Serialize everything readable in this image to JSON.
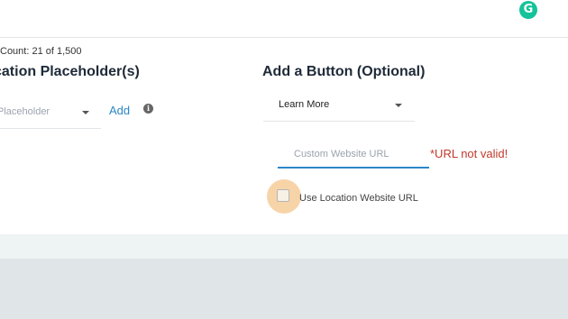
{
  "header": {
    "grammarly_letter": "G"
  },
  "character_count": "Count: 21 of 1,500",
  "location_section": {
    "title": "cation Placeholder(s)",
    "select_placeholder": "Placeholder",
    "add_label": "Add",
    "info_icon": "i"
  },
  "button_section": {
    "title": "Add a Button (Optional)",
    "selected_action": "Learn More",
    "url_placeholder": "Custom Website URL",
    "url_value": "",
    "error_text": "*URL not valid!",
    "checkbox_label": "Use Location Website URL",
    "checkbox_checked": false
  },
  "colors": {
    "accent": "#2a86c7",
    "error": "#c0392b",
    "grammarly": "#15c39a",
    "highlight": "#f1b060"
  }
}
